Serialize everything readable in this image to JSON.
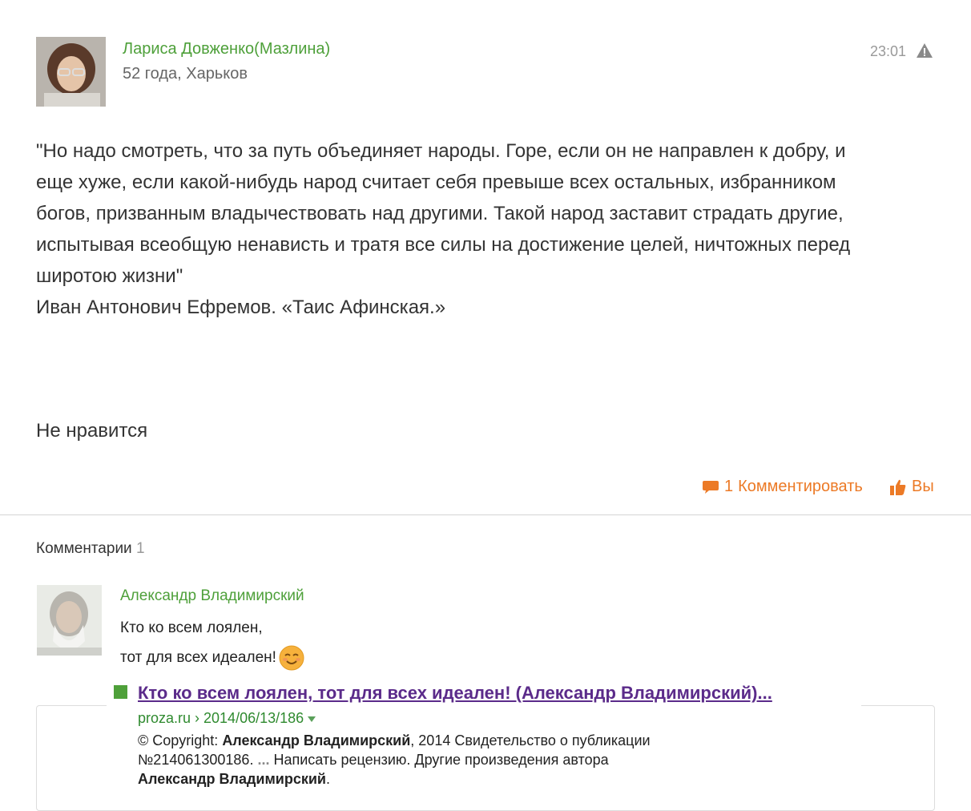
{
  "post": {
    "author_name": "Лариса Довженко(Мазлина)",
    "author_meta": "52 года, Харьков",
    "time": "23:01",
    "text": "\"Но надо смотреть, что за путь объединяет народы. Горе, если он не направлен к добру, и\nеще хуже, если какой-нибудь народ считает себя превыше всех остальных, избранником\nбогов, призванным владычествовать над другими. Такой народ заставит страдать другие,\nиспытывая всеобщую ненависть и тратя все силы на достижение целей, ничтожных перед\nширотою жизни\"\nИван Антонович Ефремов. «Таис Афинская.»",
    "status_text": "Не нравится",
    "comment_count": "1",
    "comment_label": "Комментировать",
    "like_label": "Вы"
  },
  "comments": {
    "title": "Комментарии",
    "count": "1",
    "items": [
      {
        "author": "Александр Владимирский",
        "line1": "Кто ко всем лоялен,",
        "line2": "тот для всех идеален!"
      }
    ]
  },
  "snippet": {
    "title": "Кто ко всем лоялен, тот для всех идеален! (Александр Владимирский)...",
    "url": "proza.ru › 2014/06/13/186",
    "desc_parts": {
      "p1": "© Copyright: ",
      "b1": "Александр Владимирский",
      "p2": ", 2014 Свидетельство о публикации",
      "p3": "№214061300186. ",
      "b2": "...",
      "p4": " Написать рецензию. Другие произведения автора",
      "b3": "Александр Владимирский",
      "p5": "."
    }
  },
  "colors": {
    "author_green": "#4ea03a",
    "action_orange": "#ec7a26",
    "link_purple": "#5b2b8a",
    "url_green": "#2f8a2f"
  },
  "icons": [
    "warning-icon",
    "comment-bubble-icon",
    "thumbs-up-icon",
    "smiley-icon",
    "green-square-icon",
    "caret-down-icon"
  ]
}
